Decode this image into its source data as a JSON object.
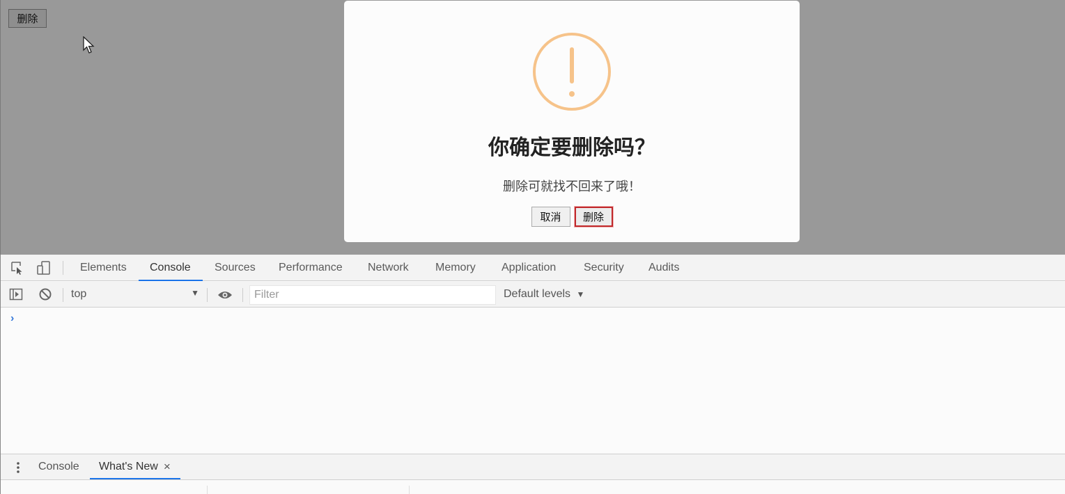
{
  "page": {
    "delete_button": "删除"
  },
  "dialog": {
    "icon": "warning-icon",
    "icon_color": "#f6c38a",
    "title": "你确定要删除吗？",
    "text": "删除可就找不回来了哦！",
    "cancel_label": "取消",
    "confirm_label": "删除",
    "confirm_border_color": "#c0282b"
  },
  "devtools": {
    "tabs": [
      "Elements",
      "Console",
      "Sources",
      "Performance",
      "Network",
      "Memory",
      "Application",
      "Security",
      "Audits"
    ],
    "active_tab": "Console",
    "context": "top",
    "filter_placeholder": "Filter",
    "levels_label": "Default levels",
    "prompt": "›",
    "drawer_tabs": [
      "Console",
      "What's New"
    ],
    "drawer_active": "What's New",
    "drawer_close": "×",
    "accent": "#1a73e8"
  }
}
